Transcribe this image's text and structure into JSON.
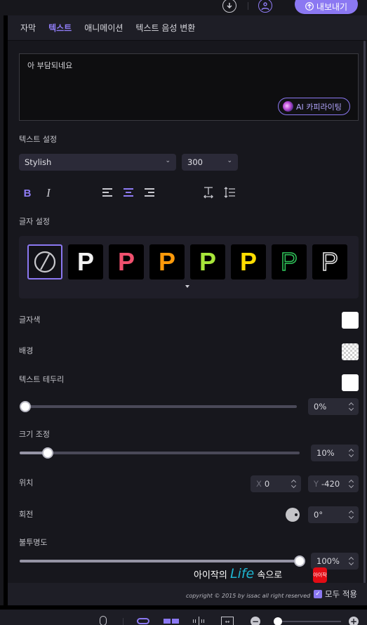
{
  "topbar": {
    "download_icon": "download-circle-icon",
    "account_icon": "user-circle-icon",
    "export_label": "내보내기",
    "export_icon": "upload-icon"
  },
  "tabs": [
    {
      "label": "자막",
      "active": false
    },
    {
      "label": "텍스트",
      "active": true
    },
    {
      "label": "애니메이션",
      "active": false
    },
    {
      "label": "텍스트 음성 변환",
      "active": false
    }
  ],
  "text_input": {
    "value": "아 부담되네요",
    "ai_button_label": "AI 카피라이팅"
  },
  "text_settings": {
    "section_label": "텍스트 설정",
    "font": "Stylish",
    "weight": "300",
    "bold_label": "B",
    "italic_label": "I",
    "alignment": "center"
  },
  "char_settings": {
    "section_label": "글자 설정",
    "presets": [
      {
        "name": "none",
        "color": "#c8c8cc",
        "style": "none",
        "selected": true
      },
      {
        "name": "white",
        "color": "#f2f2f2",
        "style": "fill",
        "selected": false
      },
      {
        "name": "pink",
        "color": "#f0506e",
        "style": "fill",
        "selected": false
      },
      {
        "name": "orange",
        "color": "#ff9a0a",
        "style": "fill",
        "selected": false
      },
      {
        "name": "lime",
        "color": "#a8e63a",
        "style": "fill",
        "selected": false
      },
      {
        "name": "yellow",
        "color": "#ffdd00",
        "style": "fill",
        "selected": false
      },
      {
        "name": "green-outline",
        "color": "#2fc55a",
        "style": "outline",
        "selected": false
      },
      {
        "name": "white-outline",
        "color": "#e6e6e6",
        "style": "outline",
        "selected": false
      }
    ],
    "preset_glyph": "P"
  },
  "colors": {
    "text_color_label": "글자색",
    "text_color": "#ffffff",
    "background_label": "배경",
    "background": "transparent",
    "border_label": "텍스트 테두리",
    "border_color": "#ffffff",
    "border_value": 0,
    "border_display": "0%"
  },
  "size": {
    "label": "크기 조정",
    "value": 10,
    "display": "10%"
  },
  "position": {
    "label": "위치",
    "x_prefix": "X",
    "x": "0",
    "y_prefix": "Y",
    "y": "-420"
  },
  "rotation": {
    "label": "회전",
    "display": "0°"
  },
  "opacity": {
    "label": "불투명도",
    "value": 100,
    "display": "100%"
  },
  "footer": {
    "apply_all_label": "모두 적용",
    "apply_all_checked": true
  },
  "watermark": {
    "prefix": "아이작의 ",
    "life": "Life",
    "suffix": " 속으로",
    "stamp": "아이작",
    "copyright": "copyright © 2015 by issac all right reserved"
  },
  "bottom_toolbar": {
    "icons": [
      "microphone-icon",
      "link-icon",
      "split-icon",
      "waveform-icon",
      "fit-width-icon",
      "zoom-out-icon",
      "zoom-in-icon"
    ],
    "zoom_level": 0.05
  },
  "theme": {
    "accent": "#8b78f2",
    "panel_bg": "#17171d"
  }
}
